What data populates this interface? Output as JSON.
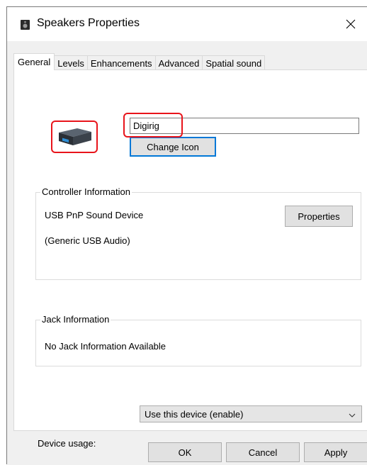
{
  "window": {
    "title": "Speakers Properties",
    "icon": "speaker-icon",
    "close_icon": "close-icon"
  },
  "tabs": [
    {
      "label": "General",
      "active": true
    },
    {
      "label": "Levels",
      "active": false
    },
    {
      "label": "Enhancements",
      "active": false
    },
    {
      "label": "Advanced",
      "active": false
    },
    {
      "label": "Spatial sound",
      "active": false
    }
  ],
  "general": {
    "device_icon": "usb-audio-device-icon",
    "device_name": "Digirig",
    "change_icon_label": "Change Icon",
    "controller": {
      "group_label": "Controller Information",
      "device_type": "USB PnP Sound Device",
      "driver": "(Generic USB Audio)",
      "properties_label": "Properties"
    },
    "jack": {
      "group_label": "Jack Information",
      "text": "No Jack Information Available"
    },
    "device_usage": {
      "label": "Device usage:",
      "selected": "Use this device (enable)"
    }
  },
  "footer": {
    "ok_label": "OK",
    "cancel_label": "Cancel",
    "apply_label": "Apply"
  },
  "colors": {
    "highlight": "#e8141b",
    "focus": "#0078d7",
    "dialog_bg": "#f0f0f0"
  }
}
